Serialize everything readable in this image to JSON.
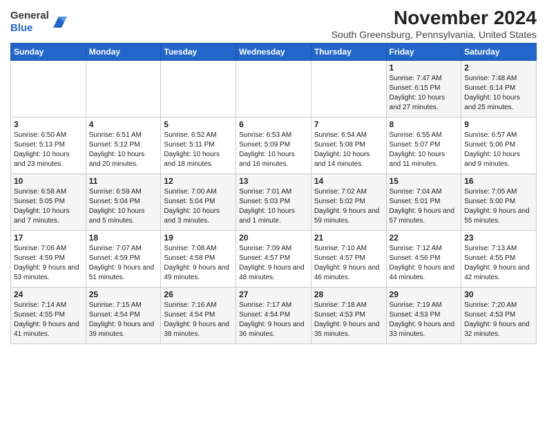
{
  "header": {
    "logo_general": "General",
    "logo_blue": "Blue",
    "title": "November 2024",
    "subtitle": "South Greensburg, Pennsylvania, United States"
  },
  "weekdays": [
    "Sunday",
    "Monday",
    "Tuesday",
    "Wednesday",
    "Thursday",
    "Friday",
    "Saturday"
  ],
  "weeks": [
    [
      {
        "day": "",
        "info": ""
      },
      {
        "day": "",
        "info": ""
      },
      {
        "day": "",
        "info": ""
      },
      {
        "day": "",
        "info": ""
      },
      {
        "day": "",
        "info": ""
      },
      {
        "day": "1",
        "info": "Sunrise: 7:47 AM\nSunset: 6:15 PM\nDaylight: 10 hours and 27 minutes."
      },
      {
        "day": "2",
        "info": "Sunrise: 7:48 AM\nSunset: 6:14 PM\nDaylight: 10 hours and 25 minutes."
      }
    ],
    [
      {
        "day": "3",
        "info": "Sunrise: 6:50 AM\nSunset: 5:13 PM\nDaylight: 10 hours and 23 minutes."
      },
      {
        "day": "4",
        "info": "Sunrise: 6:51 AM\nSunset: 5:12 PM\nDaylight: 10 hours and 20 minutes."
      },
      {
        "day": "5",
        "info": "Sunrise: 6:52 AM\nSunset: 5:11 PM\nDaylight: 10 hours and 18 minutes."
      },
      {
        "day": "6",
        "info": "Sunrise: 6:53 AM\nSunset: 5:09 PM\nDaylight: 10 hours and 16 minutes."
      },
      {
        "day": "7",
        "info": "Sunrise: 6:54 AM\nSunset: 5:08 PM\nDaylight: 10 hours and 14 minutes."
      },
      {
        "day": "8",
        "info": "Sunrise: 6:55 AM\nSunset: 5:07 PM\nDaylight: 10 hours and 11 minutes."
      },
      {
        "day": "9",
        "info": "Sunrise: 6:57 AM\nSunset: 5:06 PM\nDaylight: 10 hours and 9 minutes."
      }
    ],
    [
      {
        "day": "10",
        "info": "Sunrise: 6:58 AM\nSunset: 5:05 PM\nDaylight: 10 hours and 7 minutes."
      },
      {
        "day": "11",
        "info": "Sunrise: 6:59 AM\nSunset: 5:04 PM\nDaylight: 10 hours and 5 minutes."
      },
      {
        "day": "12",
        "info": "Sunrise: 7:00 AM\nSunset: 5:04 PM\nDaylight: 10 hours and 3 minutes."
      },
      {
        "day": "13",
        "info": "Sunrise: 7:01 AM\nSunset: 5:03 PM\nDaylight: 10 hours and 1 minute."
      },
      {
        "day": "14",
        "info": "Sunrise: 7:02 AM\nSunset: 5:02 PM\nDaylight: 9 hours and 59 minutes."
      },
      {
        "day": "15",
        "info": "Sunrise: 7:04 AM\nSunset: 5:01 PM\nDaylight: 9 hours and 57 minutes."
      },
      {
        "day": "16",
        "info": "Sunrise: 7:05 AM\nSunset: 5:00 PM\nDaylight: 9 hours and 55 minutes."
      }
    ],
    [
      {
        "day": "17",
        "info": "Sunrise: 7:06 AM\nSunset: 4:59 PM\nDaylight: 9 hours and 53 minutes."
      },
      {
        "day": "18",
        "info": "Sunrise: 7:07 AM\nSunset: 4:59 PM\nDaylight: 9 hours and 51 minutes."
      },
      {
        "day": "19",
        "info": "Sunrise: 7:08 AM\nSunset: 4:58 PM\nDaylight: 9 hours and 49 minutes."
      },
      {
        "day": "20",
        "info": "Sunrise: 7:09 AM\nSunset: 4:57 PM\nDaylight: 9 hours and 48 minutes."
      },
      {
        "day": "21",
        "info": "Sunrise: 7:10 AM\nSunset: 4:57 PM\nDaylight: 9 hours and 46 minutes."
      },
      {
        "day": "22",
        "info": "Sunrise: 7:12 AM\nSunset: 4:56 PM\nDaylight: 9 hours and 44 minutes."
      },
      {
        "day": "23",
        "info": "Sunrise: 7:13 AM\nSunset: 4:55 PM\nDaylight: 9 hours and 42 minutes."
      }
    ],
    [
      {
        "day": "24",
        "info": "Sunrise: 7:14 AM\nSunset: 4:55 PM\nDaylight: 9 hours and 41 minutes."
      },
      {
        "day": "25",
        "info": "Sunrise: 7:15 AM\nSunset: 4:54 PM\nDaylight: 9 hours and 39 minutes."
      },
      {
        "day": "26",
        "info": "Sunrise: 7:16 AM\nSunset: 4:54 PM\nDaylight: 9 hours and 38 minutes."
      },
      {
        "day": "27",
        "info": "Sunrise: 7:17 AM\nSunset: 4:54 PM\nDaylight: 9 hours and 36 minutes."
      },
      {
        "day": "28",
        "info": "Sunrise: 7:18 AM\nSunset: 4:53 PM\nDaylight: 9 hours and 35 minutes."
      },
      {
        "day": "29",
        "info": "Sunrise: 7:19 AM\nSunset: 4:53 PM\nDaylight: 9 hours and 33 minutes."
      },
      {
        "day": "30",
        "info": "Sunrise: 7:20 AM\nSunset: 4:53 PM\nDaylight: 9 hours and 32 minutes."
      }
    ]
  ]
}
